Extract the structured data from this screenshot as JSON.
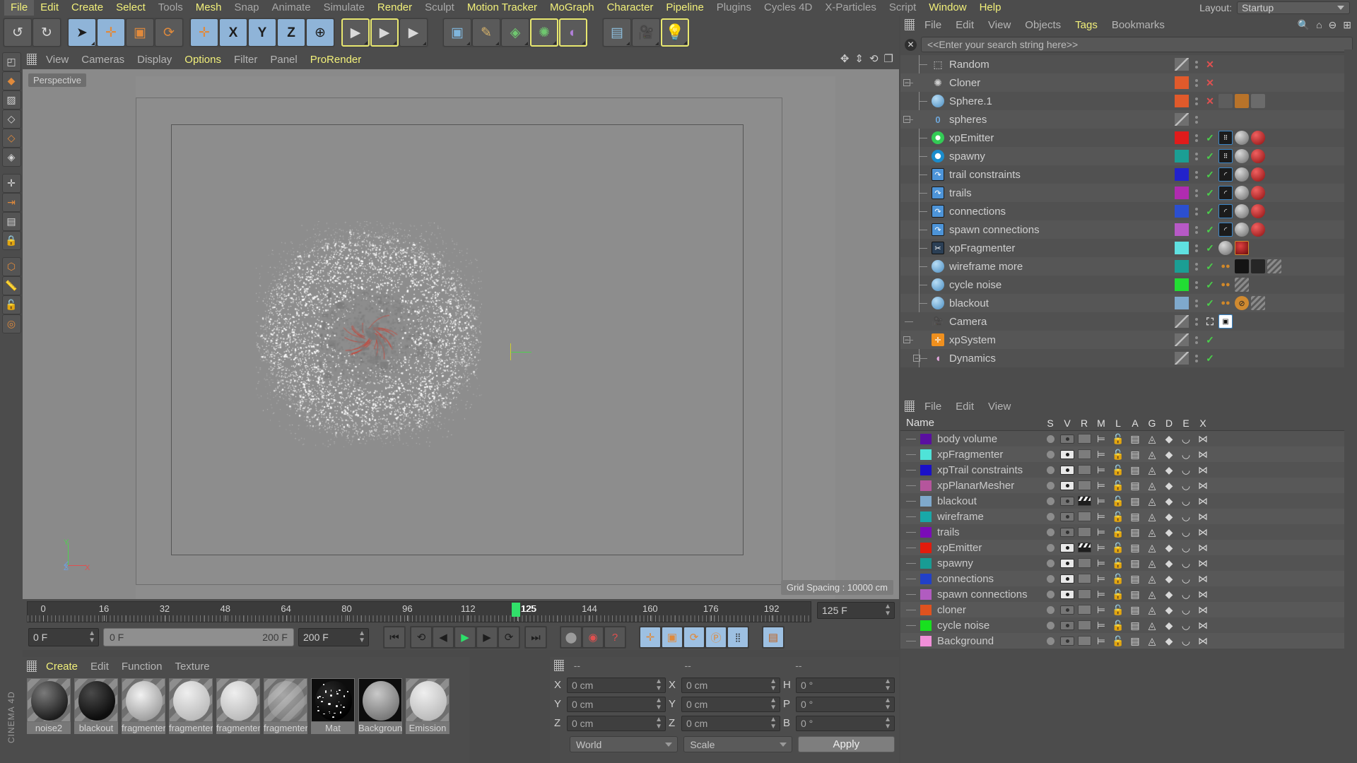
{
  "app": {
    "name": "CINEMA 4D",
    "brand_vertical": "CINEMA 4D"
  },
  "menubar": {
    "items": [
      {
        "label": "File",
        "highlight": true,
        "active": true
      },
      {
        "label": "Edit",
        "highlight": true
      },
      {
        "label": "Create",
        "highlight": true
      },
      {
        "label": "Select",
        "highlight": true
      },
      {
        "label": "Tools",
        "highlight": false
      },
      {
        "label": "Mesh",
        "highlight": true
      },
      {
        "label": "Snap",
        "highlight": false
      },
      {
        "label": "Animate",
        "highlight": false
      },
      {
        "label": "Simulate",
        "highlight": false
      },
      {
        "label": "Render",
        "highlight": true
      },
      {
        "label": "Sculpt",
        "highlight": false
      },
      {
        "label": "Motion Tracker",
        "highlight": true
      },
      {
        "label": "MoGraph",
        "highlight": true
      },
      {
        "label": "Character",
        "highlight": true
      },
      {
        "label": "Pipeline",
        "highlight": true
      },
      {
        "label": "Plugins",
        "highlight": false
      },
      {
        "label": "Cycles 4D",
        "highlight": false
      },
      {
        "label": "X-Particles",
        "highlight": false
      },
      {
        "label": "Script",
        "highlight": false
      },
      {
        "label": "Window",
        "highlight": true
      },
      {
        "label": "Help",
        "highlight": true
      }
    ],
    "layout_label": "Layout:",
    "layout_value": "Startup"
  },
  "toolbar": {
    "buttons": [
      {
        "name": "undo-button",
        "icon": "↺",
        "selected": false
      },
      {
        "name": "redo-button",
        "icon": "↻",
        "selected": false
      },
      {
        "name": "live-selection-tool",
        "icon": "➤",
        "selected": true
      },
      {
        "name": "move-tool",
        "icon": "✛",
        "selected": true
      },
      {
        "name": "scale-tool",
        "icon": "▣",
        "selected": false
      },
      {
        "name": "rotate-tool",
        "icon": "⟳",
        "selected": false
      },
      {
        "name": "global-local-axis",
        "icon": "✛",
        "selected": false
      },
      {
        "name": "x-axis-lock",
        "label": "X",
        "selected": true
      },
      {
        "name": "y-axis-lock",
        "label": "Y",
        "selected": true
      },
      {
        "name": "z-axis-lock",
        "label": "Z",
        "selected": true
      },
      {
        "name": "world-coordinate-system",
        "icon": "⊕",
        "selected": true
      },
      {
        "name": "render-view-button",
        "icon": "▶",
        "selected": false,
        "highlight": true
      },
      {
        "name": "render-region-button",
        "icon": "▶",
        "selected": false,
        "highlight": true
      },
      {
        "name": "render-settings-button",
        "icon": "▶",
        "selected": false
      },
      {
        "name": "cube-primitive-button",
        "icon": "▣",
        "selected": false
      },
      {
        "name": "spline-pen-button",
        "icon": "✎",
        "selected": false
      },
      {
        "name": "generator-button",
        "icon": "◈",
        "selected": false
      },
      {
        "name": "mograph-cloner-button",
        "icon": "✺",
        "selected": false,
        "highlight": true
      },
      {
        "name": "deformer-button",
        "icon": "◐",
        "selected": false,
        "highlight": true
      },
      {
        "name": "scene-environment-button",
        "icon": "▤",
        "selected": false
      },
      {
        "name": "camera-button",
        "icon": "🎥",
        "selected": false
      },
      {
        "name": "light-button",
        "icon": "💡",
        "selected": false,
        "highlight": true
      }
    ]
  },
  "left_tools": [
    {
      "name": "tool-make-editable",
      "icon": "◰"
    },
    {
      "name": "tool-model-mode",
      "icon": "◆"
    },
    {
      "name": "tool-texture-mode",
      "icon": "▨"
    },
    {
      "name": "tool-points-mode",
      "icon": "◇"
    },
    {
      "name": "tool-edges-mode",
      "icon": "◇"
    },
    {
      "name": "tool-polygons-mode",
      "icon": "◈"
    },
    {
      "name": "tool-enable-axis",
      "icon": "✛"
    },
    {
      "name": "tool-enable-snap",
      "icon": "⇥"
    },
    {
      "name": "tool-workplane",
      "icon": "▤"
    },
    {
      "name": "tool-lock-xyz",
      "icon": "🔒"
    },
    {
      "name": "tool-animation-layers",
      "icon": "⬡"
    },
    {
      "name": "tool-measure",
      "icon": "📏"
    },
    {
      "name": "tool-lock-axis",
      "icon": "🔓"
    },
    {
      "name": "tool-viewport-solo",
      "icon": "◎"
    }
  ],
  "viewport": {
    "menu": [
      {
        "label": "View",
        "highlight": false
      },
      {
        "label": "Cameras",
        "highlight": false
      },
      {
        "label": "Display",
        "highlight": false
      },
      {
        "label": "Options",
        "highlight": true
      },
      {
        "label": "Filter",
        "highlight": false
      },
      {
        "label": "Panel",
        "highlight": false
      },
      {
        "label": "ProRender",
        "highlight": true
      }
    ],
    "perspective_label": "Perspective",
    "grid_spacing": "Grid Spacing : 10000 cm",
    "axis_labels": {
      "y": "Y",
      "z": "Z",
      "x": "X"
    },
    "nav_icons": [
      "pan-icon",
      "dolly-icon",
      "orbit-icon",
      "maximize-viewport-icon"
    ]
  },
  "timeline": {
    "ticks": [
      "0",
      "16",
      "32",
      "48",
      "64",
      "80",
      "96",
      "112",
      "125",
      "144",
      "160",
      "176",
      "192"
    ],
    "tick_positions": [
      0,
      8.33,
      16.67,
      25,
      33.33,
      41.67,
      50,
      58.33,
      65.1,
      75,
      83.33,
      91.67,
      100
    ],
    "playhead_frame": "125",
    "current_frame_field": "125 F",
    "start_field": "0 F",
    "range_start": "0 F",
    "range_end": "200 F",
    "end_field": "200 F"
  },
  "transport": {
    "buttons": [
      {
        "name": "goto-start-button",
        "icon": "⏮"
      },
      {
        "name": "previous-key-button",
        "icon": "⟲"
      },
      {
        "name": "step-back-button",
        "icon": "◀"
      },
      {
        "name": "play-button",
        "icon": "▶"
      },
      {
        "name": "step-forward-button",
        "icon": "▶"
      },
      {
        "name": "next-key-button",
        "icon": "⟳"
      },
      {
        "name": "goto-end-button",
        "icon": "⏭"
      },
      {
        "name": "record-active-objects-button",
        "icon": "⬤"
      },
      {
        "name": "autokeying-button",
        "icon": "◉"
      },
      {
        "name": "keyframe-selection-button",
        "icon": "?"
      },
      {
        "name": "position-key-button",
        "icon": "✛"
      },
      {
        "name": "scale-key-button",
        "icon": "▣"
      },
      {
        "name": "rotation-key-button",
        "icon": "⟳"
      },
      {
        "name": "parameter-key-button",
        "icon": "Ⓟ"
      },
      {
        "name": "point-level-animation-button",
        "icon": "⦙⦙"
      },
      {
        "name": "timeline-button",
        "icon": "▤"
      }
    ]
  },
  "material_manager": {
    "menu": [
      {
        "label": "Create",
        "highlight": true
      },
      {
        "label": "Edit",
        "highlight": false
      },
      {
        "label": "Function",
        "highlight": false
      },
      {
        "label": "Texture",
        "highlight": false
      }
    ],
    "materials": [
      {
        "name": "noise2",
        "style": "noise-dark"
      },
      {
        "name": "blackout",
        "style": "black"
      },
      {
        "name": "fragmenter",
        "style": "smoke"
      },
      {
        "name": "fragmenter",
        "style": "light-gray"
      },
      {
        "name": "fragmenter",
        "style": "light-gray"
      },
      {
        "name": "fragmenter",
        "style": "transparent"
      },
      {
        "name": "Mat",
        "style": "black-speckle"
      },
      {
        "name": "Background",
        "style": "grain"
      },
      {
        "name": "Emission",
        "style": "light-gray"
      }
    ]
  },
  "coordinate_manager": {
    "headers": [
      "--",
      "--",
      "--"
    ],
    "rows": [
      {
        "label_pos": "X",
        "value_pos": "0 cm",
        "label_size": "X",
        "value_size": "0 cm",
        "label_rot": "H",
        "value_rot": "0 °"
      },
      {
        "label_pos": "Y",
        "value_pos": "0 cm",
        "label_size": "Y",
        "value_size": "0 cm",
        "label_rot": "P",
        "value_rot": "0 °"
      },
      {
        "label_pos": "Z",
        "value_pos": "0 cm",
        "label_size": "Z",
        "value_size": "0 cm",
        "label_rot": "B",
        "value_rot": "0 °"
      }
    ],
    "system_select": "World",
    "mode_select": "Scale",
    "apply_label": "Apply"
  },
  "object_manager": {
    "menu": [
      {
        "label": "File",
        "highlight": false
      },
      {
        "label": "Edit",
        "highlight": false
      },
      {
        "label": "View",
        "highlight": false
      },
      {
        "label": "Objects",
        "highlight": false
      },
      {
        "label": "Tags",
        "highlight": true
      },
      {
        "label": "Bookmarks",
        "highlight": false
      }
    ],
    "search_placeholder": "<<Enter your search string here>>",
    "objects": [
      {
        "name": "Random",
        "icon": "random-effector-icon",
        "icon_color": "#cccccc",
        "depth": 1,
        "expander": false,
        "swatch": "none",
        "state": "x",
        "state_color": "#e05050",
        "tags": []
      },
      {
        "name": "Cloner",
        "icon": "cloner-icon",
        "icon_color": "#d8d8d8",
        "depth": 0,
        "expander": true,
        "swatch": "#e05a2b",
        "state": "x",
        "state_color": "#e05050",
        "tags": []
      },
      {
        "name": "Sphere.1",
        "icon": "sphere-icon",
        "icon_color": "#6fb4e8",
        "depth": 1,
        "expander": false,
        "swatch": "#e05a2b",
        "state": "x",
        "state_color": "#e05050",
        "tags": [
          "texture-tag",
          "point-tag",
          "texture-tag2"
        ]
      },
      {
        "name": "spheres",
        "icon": "null-object-icon",
        "icon_color": "#cfcfcf",
        "depth": 0,
        "expander": true,
        "swatch": "none",
        "state": "",
        "state_color": "#8e8e8e",
        "tags": []
      },
      {
        "name": "xpEmitter",
        "icon": "xpemitter-icon",
        "icon_color": "#33cc55",
        "depth": 1,
        "expander": false,
        "swatch": "#e01b1b",
        "state": "check",
        "state_color": "#4ad04a",
        "tags": [
          "dice-tag",
          "sphere-tag",
          "apple-tag"
        ]
      },
      {
        "name": "spawny",
        "icon": "xpspawn-icon",
        "icon_color": "#2bb8a8",
        "depth": 1,
        "expander": false,
        "swatch": "#1b9e94",
        "state": "check",
        "state_color": "#4ad04a",
        "tags": [
          "dice-tag",
          "sphere-tag",
          "apple-tag"
        ]
      },
      {
        "name": "trail constraints",
        "icon": "xptrail-icon",
        "icon_color": "#4d94d8",
        "depth": 1,
        "expander": false,
        "swatch": "#2222cc",
        "state": "check",
        "state_color": "#4ad04a",
        "tags": [
          "curve-tag",
          "sphere-tag",
          "apple-tag"
        ]
      },
      {
        "name": "trails",
        "icon": "xptrail-icon",
        "icon_color": "#4d94d8",
        "depth": 1,
        "expander": false,
        "swatch": "#b02bb0",
        "state": "check",
        "state_color": "#4ad04a",
        "tags": [
          "curve-tag",
          "sphere-tag",
          "apple-tag"
        ]
      },
      {
        "name": "connections",
        "icon": "xptrail-icon",
        "icon_color": "#4d94d8",
        "depth": 1,
        "expander": false,
        "swatch": "#2b4fd0",
        "state": "check",
        "state_color": "#4ad04a",
        "tags": [
          "curve-tag",
          "sphere-tag",
          "apple-tag"
        ]
      },
      {
        "name": "spawn connections",
        "icon": "xptrail-icon",
        "icon_color": "#4d94d8",
        "depth": 1,
        "expander": false,
        "swatch": "#b759c6",
        "state": "check",
        "state_color": "#4ad04a",
        "tags": [
          "curve-tag",
          "sphere-tag",
          "apple-tag"
        ]
      },
      {
        "name": "xpFragmenter",
        "icon": "xpfragmenter-icon",
        "icon_color": "#dddddd",
        "depth": 1,
        "expander": false,
        "swatch": "#5fe0e0",
        "state": "check",
        "state_color": "#4ad04a",
        "tags": [
          "sphere-tag",
          "red-ball-tag"
        ]
      },
      {
        "name": "wireframe more",
        "icon": "sphere-icon",
        "icon_color": "#6fb4e8",
        "depth": 1,
        "expander": false,
        "swatch": "#1b9e94",
        "state": "check",
        "state_color": "#4ad04a",
        "tags": [
          "material-tag",
          "black-tag",
          "dark-tag",
          "stripe-tag"
        ]
      },
      {
        "name": "cycle noise",
        "icon": "sphere-icon",
        "icon_color": "#6fb4e8",
        "depth": 1,
        "expander": false,
        "swatch": "#22dd33",
        "state": "check",
        "state_color": "#4ad04a",
        "tags": [
          "material-tag",
          "stripe-tag"
        ]
      },
      {
        "name": "blackout",
        "icon": "sphere-icon",
        "icon_color": "#6fb4e8",
        "depth": 1,
        "expander": false,
        "swatch": "#7fa9cc",
        "state": "check",
        "state_color": "#4ad04a",
        "tags": [
          "material-tag",
          "orange-circle-tag",
          "stripe-tag"
        ]
      },
      {
        "name": "Camera",
        "icon": "camera-icon",
        "icon_color": "#1e1e1e",
        "depth": 0,
        "expander": false,
        "swatch": "none",
        "state": "target",
        "state_color": "#d8d8d8",
        "tags": [
          "camera-tag"
        ]
      },
      {
        "name": "xpSystem",
        "icon": "xpsystem-icon",
        "icon_color": "#f0901e",
        "depth": 0,
        "expander": true,
        "swatch": "none",
        "state": "check",
        "state_color": "#4ad04a",
        "tags": []
      },
      {
        "name": "Dynamics",
        "icon": "dynamics-icon",
        "icon_color": "#e7a8e0",
        "depth": 1,
        "expander": true,
        "swatch": "none",
        "state": "check",
        "state_color": "#4ad04a",
        "tags": []
      }
    ]
  },
  "layer_manager": {
    "menu": [
      {
        "label": "File"
      },
      {
        "label": "Edit"
      },
      {
        "label": "View"
      }
    ],
    "columns": [
      "Name",
      "S",
      "V",
      "R",
      "M",
      "L",
      "A",
      "G",
      "D",
      "E",
      "X"
    ],
    "layers": [
      {
        "name": "body volume",
        "color": "#5a0fa0",
        "solo": false,
        "visible": false,
        "render": false
      },
      {
        "name": "xpFragmenter",
        "color": "#4fe3d8",
        "solo": false,
        "visible": true,
        "render": false
      },
      {
        "name": "xpTrail constraints",
        "color": "#1a10c8",
        "solo": false,
        "visible": true,
        "render": false
      },
      {
        "name": "xpPlanarMesher",
        "color": "#b5559c",
        "solo": false,
        "visible": true,
        "render": false
      },
      {
        "name": "blackout",
        "color": "#7fa9cc",
        "solo": false,
        "visible": false,
        "render": true
      },
      {
        "name": "wireframe",
        "color": "#18a8a8",
        "solo": false,
        "visible": false,
        "render": false
      },
      {
        "name": "trails",
        "color": "#7a0cb8",
        "solo": false,
        "visible": false,
        "render": false
      },
      {
        "name": "xpEmitter",
        "color": "#e31b0c",
        "solo": false,
        "visible": true,
        "render": true
      },
      {
        "name": "spawny",
        "color": "#189c94",
        "solo": false,
        "visible": true,
        "render": false
      },
      {
        "name": "connections",
        "color": "#2240c8",
        "solo": false,
        "visible": true,
        "render": false
      },
      {
        "name": "spawn connections",
        "color": "#b15cc0",
        "solo": false,
        "visible": true,
        "render": false
      },
      {
        "name": "cloner",
        "color": "#e0521f",
        "solo": false,
        "visible": false,
        "render": false
      },
      {
        "name": "cycle noise",
        "color": "#18e01f",
        "solo": false,
        "visible": false,
        "render": false
      },
      {
        "name": "Background",
        "color": "#f08fd8",
        "solo": false,
        "visible": false,
        "render": false
      }
    ]
  }
}
